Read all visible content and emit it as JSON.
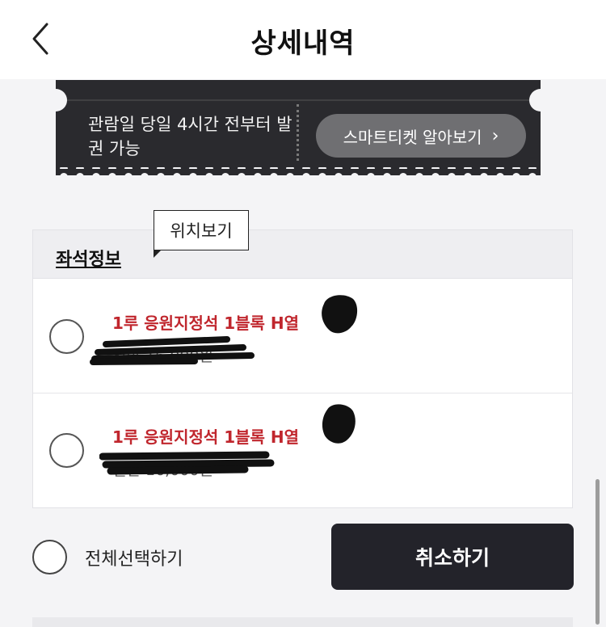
{
  "header": {
    "title": "상세내역"
  },
  "ticket": {
    "notice": "관람일 당일 4시간 전부터 발권 가능",
    "smart_ticket_button": "스마트티켓 알아보기",
    "chevron": "›"
  },
  "seat_info": {
    "title": "좌석정보",
    "location_tooltip": "위치보기",
    "seats": [
      {
        "name": "1루 응원지정석 1블록 H열",
        "price": "일반 16,000원"
      },
      {
        "name": "1루 응원지정석 1블록 H열",
        "price": "일반 16,000원"
      }
    ]
  },
  "footer": {
    "select_all_label": "전체선택하기",
    "cancel_button": "취소하기"
  },
  "colors": {
    "accent_red": "#c0262d",
    "dark": "#23232a",
    "ticket_bg": "#2a2a2e"
  }
}
